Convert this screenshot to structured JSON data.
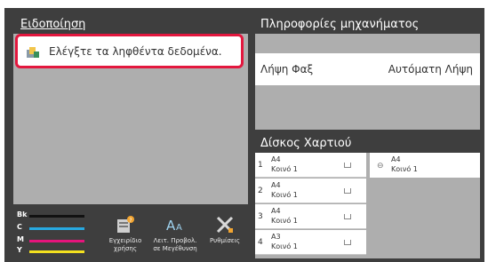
{
  "notification": {
    "title": "Ειδοποίηση",
    "message": "Ελέγξτε τα ληφθέντα δεδομένα."
  },
  "machine_info": {
    "title": "Πληροφορίες μηχανήματος",
    "fax_label": "Λήψη Φαξ",
    "fax_value": "Αυτόματη Λήψη"
  },
  "paper_tray": {
    "title": "Δίσκος Χαρτιού",
    "trays": [
      {
        "number": "1",
        "size": "A4",
        "type": "Κοινό 1"
      },
      {
        "number": "2",
        "size": "A4",
        "type": "Κοινό 1"
      },
      {
        "number": "3",
        "size": "A4",
        "type": "Κοινό 1"
      },
      {
        "number": "4",
        "size": "A3",
        "type": "Κοινό 1"
      }
    ],
    "bypass": {
      "size": "A4",
      "type": "Κοινό 1"
    }
  },
  "toner": {
    "labels": [
      "Bk",
      "C",
      "M",
      "Y"
    ],
    "colors": [
      "#111111",
      "#27a9e1",
      "#e5147c",
      "#f4e11f"
    ]
  },
  "tools": {
    "manual": "Εγχειρίδιο χρήσης",
    "font_size": "Λειτ. Προβολ. σε Μεγέθυνση",
    "settings": "Ρυθμίσεις"
  }
}
